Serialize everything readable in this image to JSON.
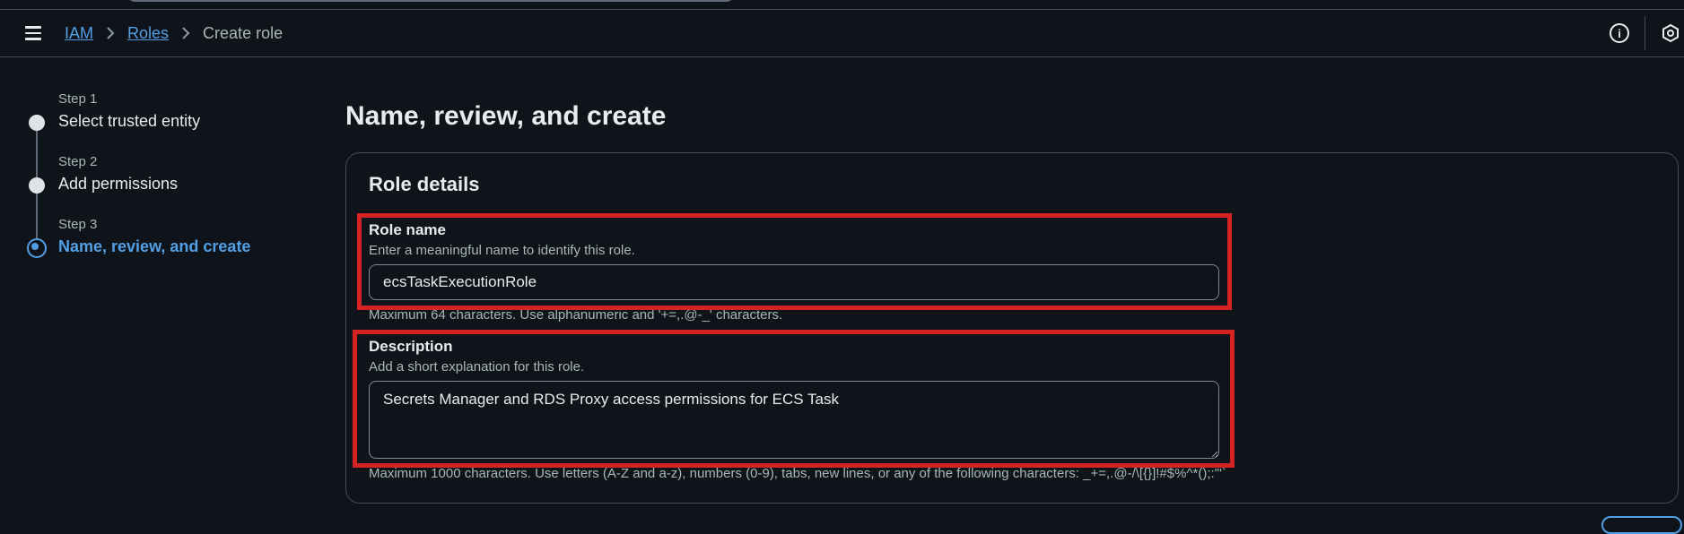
{
  "breadcrumb": {
    "items": [
      "IAM",
      "Roles"
    ],
    "current": "Create role"
  },
  "steps": [
    {
      "caption": "Step 1",
      "title": "Select trusted entity"
    },
    {
      "caption": "Step 2",
      "title": "Add permissions"
    },
    {
      "caption": "Step 3",
      "title": "Name, review, and create"
    }
  ],
  "page": {
    "title": "Name, review, and create"
  },
  "role_details": {
    "title": "Role details",
    "role_name": {
      "label": "Role name",
      "description": "Enter a meaningful name to identify this role.",
      "value": "ecsTaskExecutionRole",
      "constraint": "Maximum 64 characters. Use alphanumeric and '+=,.@-_' characters."
    },
    "description": {
      "label": "Description",
      "description": "Add a short explanation for this role.",
      "value": "Secrets Manager and RDS Proxy access permissions for ECS Task",
      "constraint": "Maximum 1000 characters. Use letters (A-Z and a-z), numbers (0-9), tabs, new lines, or any of the following characters: _+=,.@-/\\[{}]!#$%^*();:'\"`"
    }
  },
  "colors": {
    "accent": "#539fe5",
    "highlight": "#d42323",
    "background": "#0f141a"
  },
  "icons": {
    "menu": "menu-icon",
    "separator": "chevron-right-icon",
    "info": "info-icon",
    "settings": "settings-icon"
  }
}
